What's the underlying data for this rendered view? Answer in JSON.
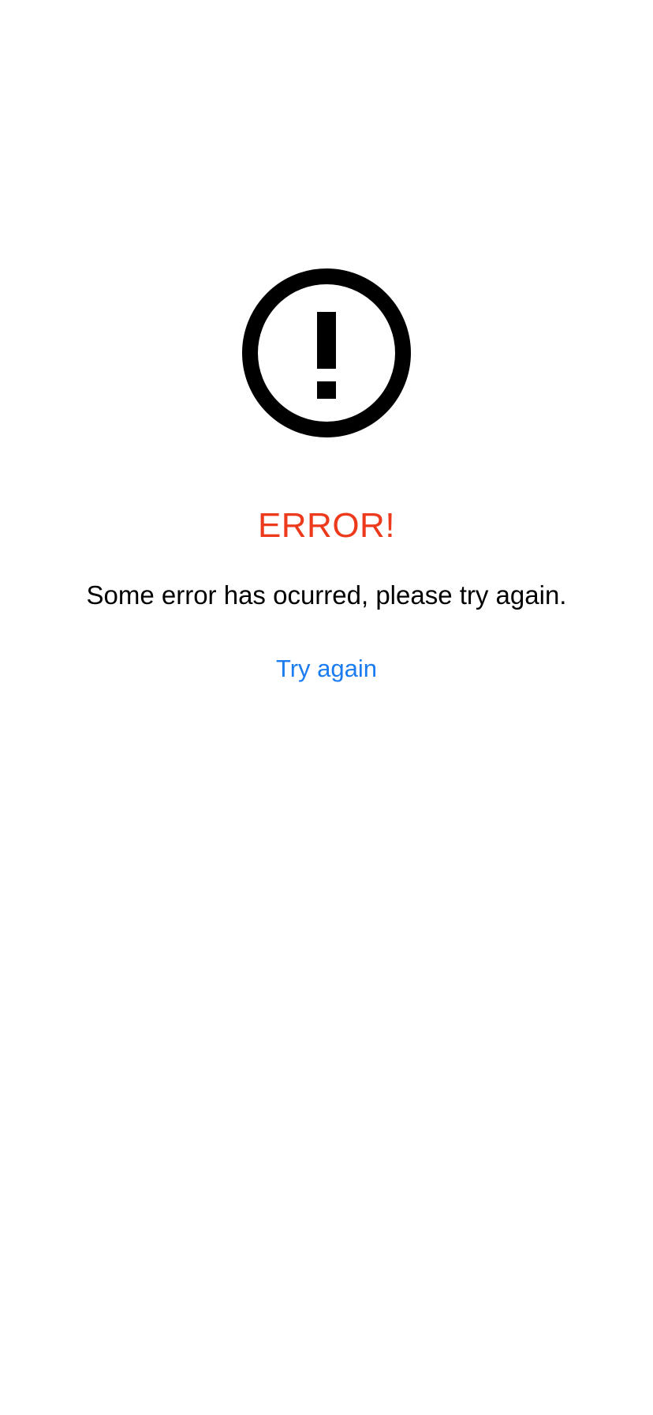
{
  "error": {
    "icon": "exclamation-circle-icon",
    "title": "ERROR!",
    "message": "Some error has ocurred, please try again.",
    "retry_label": "Try again"
  },
  "colors": {
    "background": "#ffffff",
    "title": "#ee3a1c",
    "message": "#000000",
    "link": "#1a7cf0",
    "icon": "#000000"
  }
}
